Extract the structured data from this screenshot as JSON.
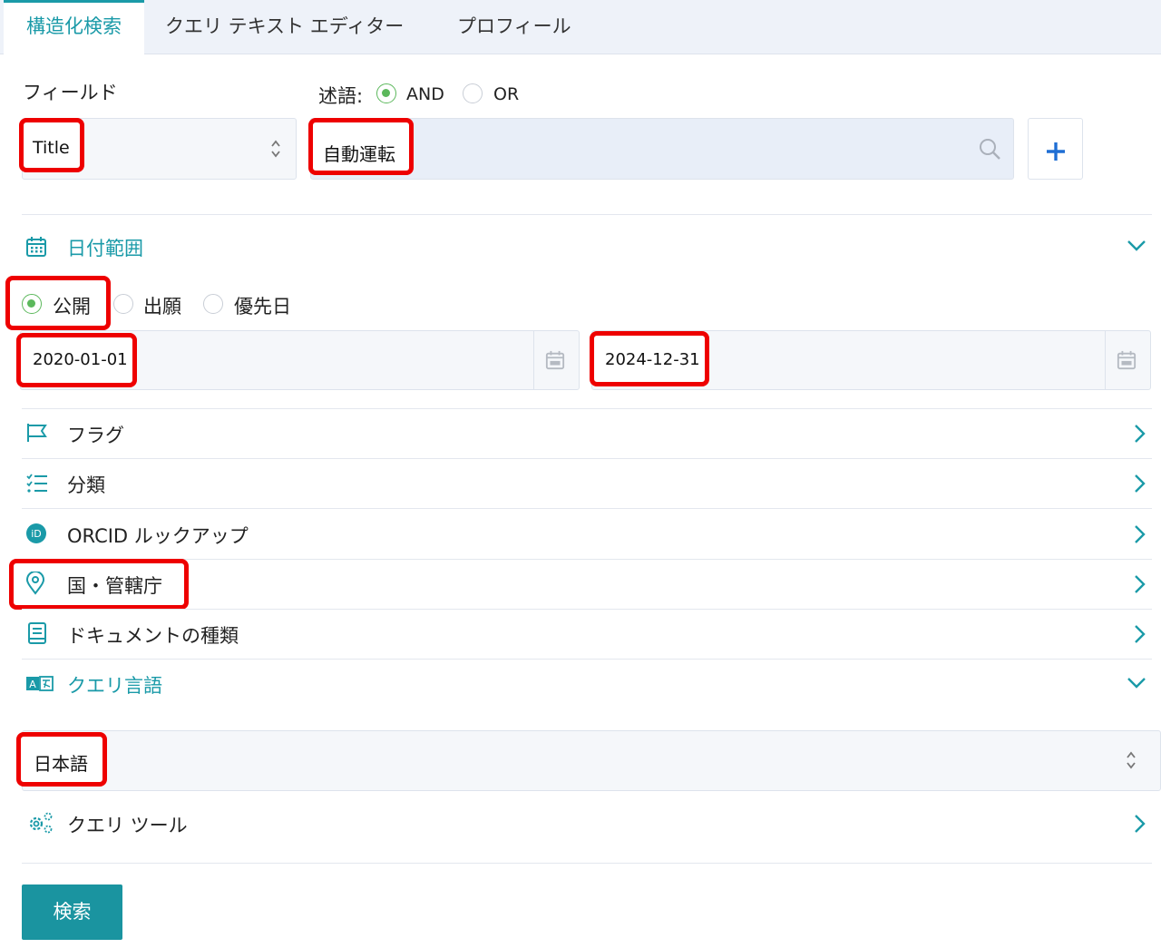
{
  "tabs": [
    {
      "label": "構造化検索",
      "active": true
    },
    {
      "label": "クエリ テキスト エディター",
      "active": false
    },
    {
      "label": "プロフィール",
      "active": false
    }
  ],
  "field": {
    "label": "フィールド",
    "selected": "Title"
  },
  "predicate": {
    "label": "述語:",
    "options": [
      "AND",
      "OR"
    ],
    "selected": "AND"
  },
  "query": {
    "value": "自動運転"
  },
  "date_range": {
    "title": "日付範囲",
    "expanded": true,
    "types": [
      "公開",
      "出願",
      "優先日"
    ],
    "selected_type": "公開",
    "from": "2020-01-01",
    "to": "2024-12-31"
  },
  "sections": [
    {
      "title": "フラグ",
      "icon": "flag-icon"
    },
    {
      "title": "分類",
      "icon": "list-check-icon"
    },
    {
      "title": "ORCID ルックアップ",
      "icon": "orcid-icon"
    },
    {
      "title": "国・管轄庁",
      "icon": "map-pin-icon"
    },
    {
      "title": "ドキュメントの種類",
      "icon": "document-icon"
    }
  ],
  "query_language": {
    "title": "クエリ言語",
    "expanded": true,
    "selected": "日本語"
  },
  "query_tools": {
    "title": "クエリ ツール"
  },
  "search_button": "検索",
  "colors": {
    "accent": "#1a9aa8",
    "button": "#1a94a0",
    "highlight": "#ee0000",
    "radio_on": "#5cb85c"
  }
}
